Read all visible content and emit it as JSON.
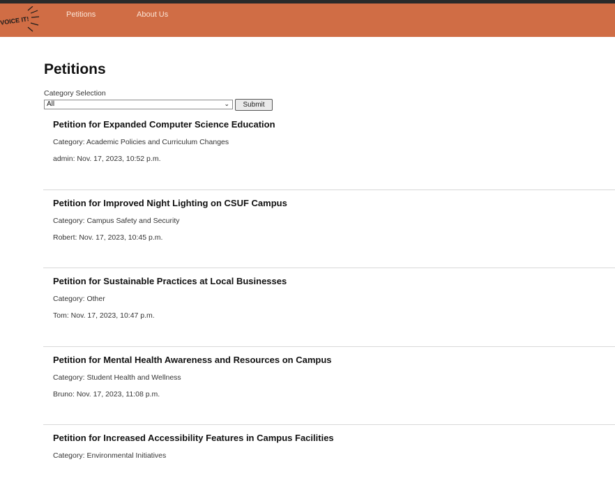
{
  "nav": {
    "logo_text": "VOICE IT!",
    "links": [
      "Petitions",
      "About Us"
    ],
    "color": "#d06d45"
  },
  "page": {
    "title": "Petitions",
    "category_label": "Category Selection",
    "category_value": "All",
    "submit_label": "Submit"
  },
  "petitions": [
    {
      "title": "Petition for Expanded Computer Science Education",
      "category": "Category: Academic Policies and Curriculum Changes",
      "meta": "admin: Nov. 17, 2023, 10:52 p.m."
    },
    {
      "title": "Petition for Improved Night Lighting on CSUF Campus",
      "category": "Category: Campus Safety and Security",
      "meta": "Robert: Nov. 17, 2023, 10:45 p.m."
    },
    {
      "title": "Petition for Sustainable Practices at Local Businesses",
      "category": "Category: Other",
      "meta": "Tom: Nov. 17, 2023, 10:47 p.m."
    },
    {
      "title": "Petition for Mental Health Awareness and Resources on Campus",
      "category": "Category: Student Health and Wellness",
      "meta": "Bruno: Nov. 17, 2023, 11:08 p.m."
    },
    {
      "title": "Petition for Increased Accessibility Features in Campus Facilities",
      "category": "Category: Environmental Initiatives",
      "meta": ""
    }
  ]
}
